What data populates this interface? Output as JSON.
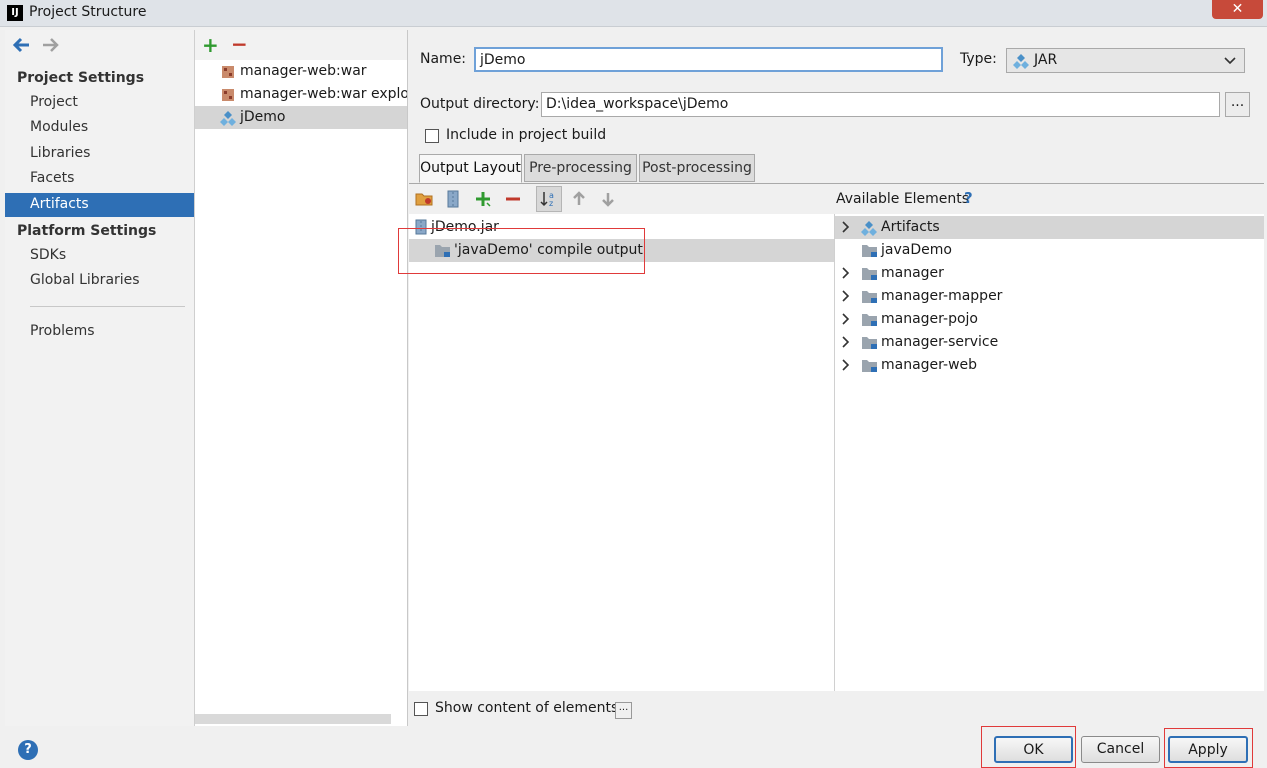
{
  "window": {
    "title": "Project Structure",
    "app_icon_text": "IJ",
    "close_label": "✕"
  },
  "nav": {
    "back_icon": "back-arrow-icon",
    "forward_icon": "forward-arrow-icon",
    "project_settings_heading": "Project Settings",
    "project_settings_items": [
      "Project",
      "Modules",
      "Libraries",
      "Facets",
      "Artifacts"
    ],
    "selected_item": "Artifacts",
    "platform_settings_heading": "Platform Settings",
    "platform_settings_items": [
      "SDKs",
      "Global Libraries"
    ],
    "problems_label": "Problems"
  },
  "artifacts": {
    "add_label": "+",
    "remove_label": "−",
    "items": [
      {
        "label": "manager-web:war",
        "icon": "war-icon"
      },
      {
        "label": "manager-web:war exploded",
        "icon": "war-icon"
      },
      {
        "label": "jDemo",
        "icon": "jar-artifact-icon"
      }
    ],
    "selected": "jDemo"
  },
  "form": {
    "name_label": "Name:",
    "name_value": "jDemo",
    "type_label": "Type:",
    "type_value": "JAR",
    "output_dir_label": "Output directory:",
    "output_dir_value": "D:\\idea_workspace\\jDemo",
    "browse_label": "...",
    "include_label": "Include in project build",
    "include_checked": false
  },
  "tabs": [
    "Output Layout",
    "Pre-processing",
    "Post-processing"
  ],
  "active_tab": "Output Layout",
  "layout": {
    "toolbar_icons": [
      "new-directory-icon",
      "archive-icon",
      "add-icon",
      "remove-icon",
      "sort-icon",
      "move-up-icon",
      "move-down-icon"
    ],
    "tree": [
      {
        "label": "jDemo.jar",
        "icon": "jar-icon"
      },
      {
        "label": "'javaDemo' compile output",
        "icon": "module-output-icon"
      }
    ],
    "show_content_label": "Show content of elements",
    "show_content_checked": false,
    "show_content_more": "..."
  },
  "available": {
    "title": "Available Elements",
    "help_label": "?",
    "items": [
      {
        "label": "Artifacts",
        "expandable": true,
        "icon": "artifacts-icon",
        "selected": true
      },
      {
        "label": "javaDemo",
        "expandable": false,
        "icon": "module-folder-icon",
        "selected": false
      },
      {
        "label": "manager",
        "expandable": true,
        "icon": "module-folder-icon",
        "selected": false
      },
      {
        "label": "manager-mapper",
        "expandable": true,
        "icon": "module-folder-icon",
        "selected": false
      },
      {
        "label": "manager-pojo",
        "expandable": true,
        "icon": "module-folder-icon",
        "selected": false
      },
      {
        "label": "manager-service",
        "expandable": true,
        "icon": "module-folder-icon",
        "selected": false
      },
      {
        "label": "manager-web",
        "expandable": true,
        "icon": "module-folder-icon",
        "selected": false
      }
    ]
  },
  "footer": {
    "help_label": "?",
    "ok_label": "OK",
    "cancel_label": "Cancel",
    "apply_label": "Apply"
  },
  "colors": {
    "selection": "#2e6fb5",
    "annotation_red": "#e03a3a",
    "add_green": "#2f9a2f",
    "remove_red": "#c0392b"
  }
}
